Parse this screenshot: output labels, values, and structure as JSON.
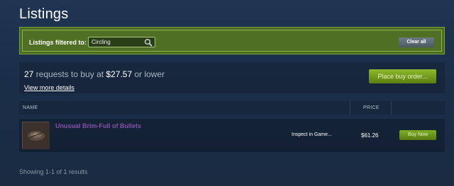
{
  "page": {
    "title": "Listings"
  },
  "filter": {
    "label": "Listings filtered to:",
    "value": "Circling",
    "clear_label": "Clear all"
  },
  "buy_orders": {
    "count": "27",
    "text_mid": " requests to buy at ",
    "price": "$27.57",
    "text_end": " or lower",
    "details_link": "View more details",
    "button_label": "Place buy order..."
  },
  "table": {
    "columns": {
      "name": "NAME",
      "price": "PRICE"
    },
    "rows": [
      {
        "name": "Unusual Brim-Full of Bullets",
        "inspect": "Inspect in Game...",
        "price": "$61.26",
        "buy_label": "Buy Now"
      }
    ]
  },
  "footer": {
    "results": "Showing 1-1 of 1 results"
  },
  "colors": {
    "unusual_name": "#8650ac",
    "accent_green": "#8dba2c",
    "filter_bg": "#4c6b22"
  },
  "icons": {
    "search": "search-icon"
  }
}
